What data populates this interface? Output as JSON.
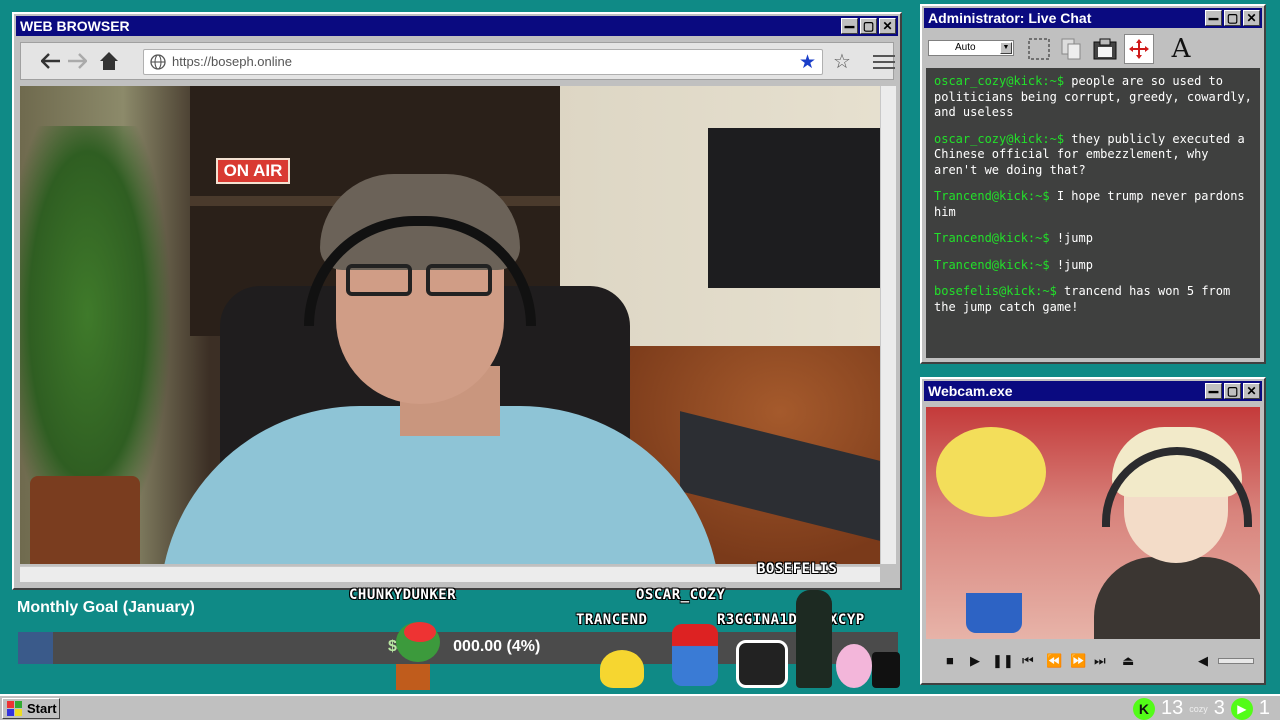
{
  "browser": {
    "title": "WEB BROWSER",
    "url": "https://boseph.online",
    "video": {
      "sign_text": "ON AIR"
    }
  },
  "chat": {
    "title": "Administrator: Live Chat",
    "font_select": "Auto",
    "tool_text_icon": "A",
    "messages": [
      {
        "prompt": "oscar_cozy@kick:~$",
        "text": " people are so used to politicians being corrupt, greedy, cowardly, and useless"
      },
      {
        "prompt": "oscar_cozy@kick:~$",
        "text": " they publicly executed a Chinese official for embezzlement, why aren't we doing that?"
      },
      {
        "prompt": "Trancend@kick:~$",
        "text": " I hope trump never pardons him"
      },
      {
        "prompt": "Trancend@kick:~$",
        "text": " !jump"
      },
      {
        "prompt": "Trancend@kick:~$",
        "text": " !jump"
      },
      {
        "prompt": "bosefelis@kick:~$",
        "text": " trancend has won 5 from the jump catch game!"
      }
    ]
  },
  "webcam": {
    "title": "Webcam.exe"
  },
  "goal": {
    "title": "Monthly Goal (January)",
    "amount_text": "$44.",
    "amount_text2": "000.00 (4%)",
    "progress": 0.04
  },
  "viewers": [
    {
      "name": "CHUNKYDUNKER"
    },
    {
      "name": "OSCAR_COZY"
    },
    {
      "name": "BOSEFELIS"
    },
    {
      "name": "TRANCEND"
    },
    {
      "name": "R3GGINA1D"
    },
    {
      "name": "XCYP"
    }
  ],
  "taskbar": {
    "start_label": "Start",
    "count_a": "13",
    "cozy_label": "cozy",
    "count_b": "3",
    "count_c": "1"
  },
  "colors": {
    "desktop": "#0f8a86",
    "titlebar": "#0a0a80",
    "prompt_green": "#22e02a",
    "bookmark_blue": "#1a3ec9"
  }
}
